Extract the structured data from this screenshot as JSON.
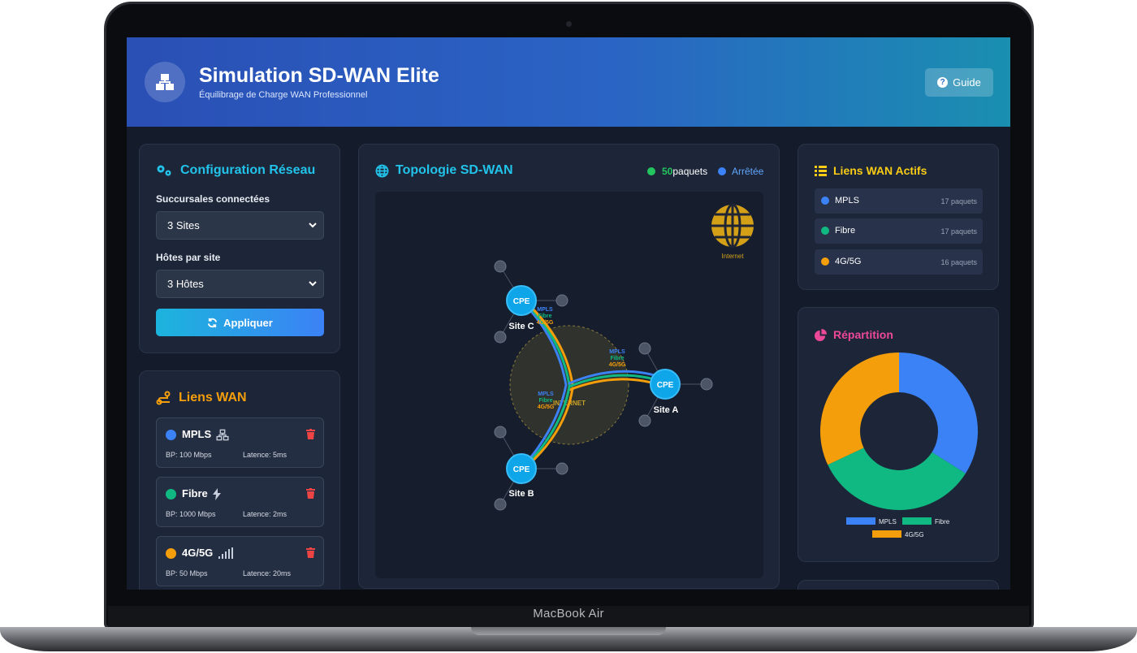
{
  "device": {
    "model_label": "MacBook Air"
  },
  "header": {
    "title": "Simulation SD-WAN Elite",
    "subtitle": "Équilibrage de Charge WAN Professionnel",
    "guide_button": "Guide"
  },
  "config": {
    "title": "Configuration Réseau",
    "sites_label": "Succursales connectées",
    "sites_value": "3 Sites",
    "hosts_label": "Hôtes par site",
    "hosts_value": "3 Hôtes",
    "apply_button": "Appliquer"
  },
  "wan_links": {
    "title": "Liens WAN",
    "items": [
      {
        "name": "MPLS",
        "bandwidth": "BP: 100 Mbps",
        "latency": "Latence: 5ms",
        "color": "#3b82f6",
        "icon": "network-icon"
      },
      {
        "name": "Fibre",
        "bandwidth": "BP: 1000 Mbps",
        "latency": "Latence: 2ms",
        "color": "#10b981",
        "icon": "bolt-icon"
      },
      {
        "name": "4G/5G",
        "bandwidth": "BP: 50 Mbps",
        "latency": "Latence: 20ms",
        "color": "#f59e0b",
        "icon": "signal-icon"
      }
    ]
  },
  "topology": {
    "title": "Topologie SD-WAN",
    "packet_count": "50",
    "packet_label": "paquets",
    "status": "Arrêtée",
    "internet_label": "Internet",
    "cloud_label": "INTERNET",
    "cpe_label": "CPE",
    "link_labels": [
      "MPLS",
      "Fibre",
      "4G/5G"
    ],
    "sites": [
      {
        "name": "Site C"
      },
      {
        "name": "Site A"
      },
      {
        "name": "Site B"
      }
    ]
  },
  "active_links": {
    "title": "Liens WAN Actifs",
    "items": [
      {
        "name": "MPLS",
        "count": "17 paquets",
        "color": "#3b82f6"
      },
      {
        "name": "Fibre",
        "count": "17 paquets",
        "color": "#10b981"
      },
      {
        "name": "4G/5G",
        "count": "16 paquets",
        "color": "#f59e0b"
      }
    ]
  },
  "distribution": {
    "title": "Répartition",
    "chart_data": {
      "type": "pie",
      "categories": [
        "MPLS",
        "Fibre",
        "4G/5G"
      ],
      "values": [
        17,
        17,
        16
      ],
      "colors": [
        "#3b82f6",
        "#10b981",
        "#f59e0b"
      ],
      "legend": "bottom"
    }
  }
}
